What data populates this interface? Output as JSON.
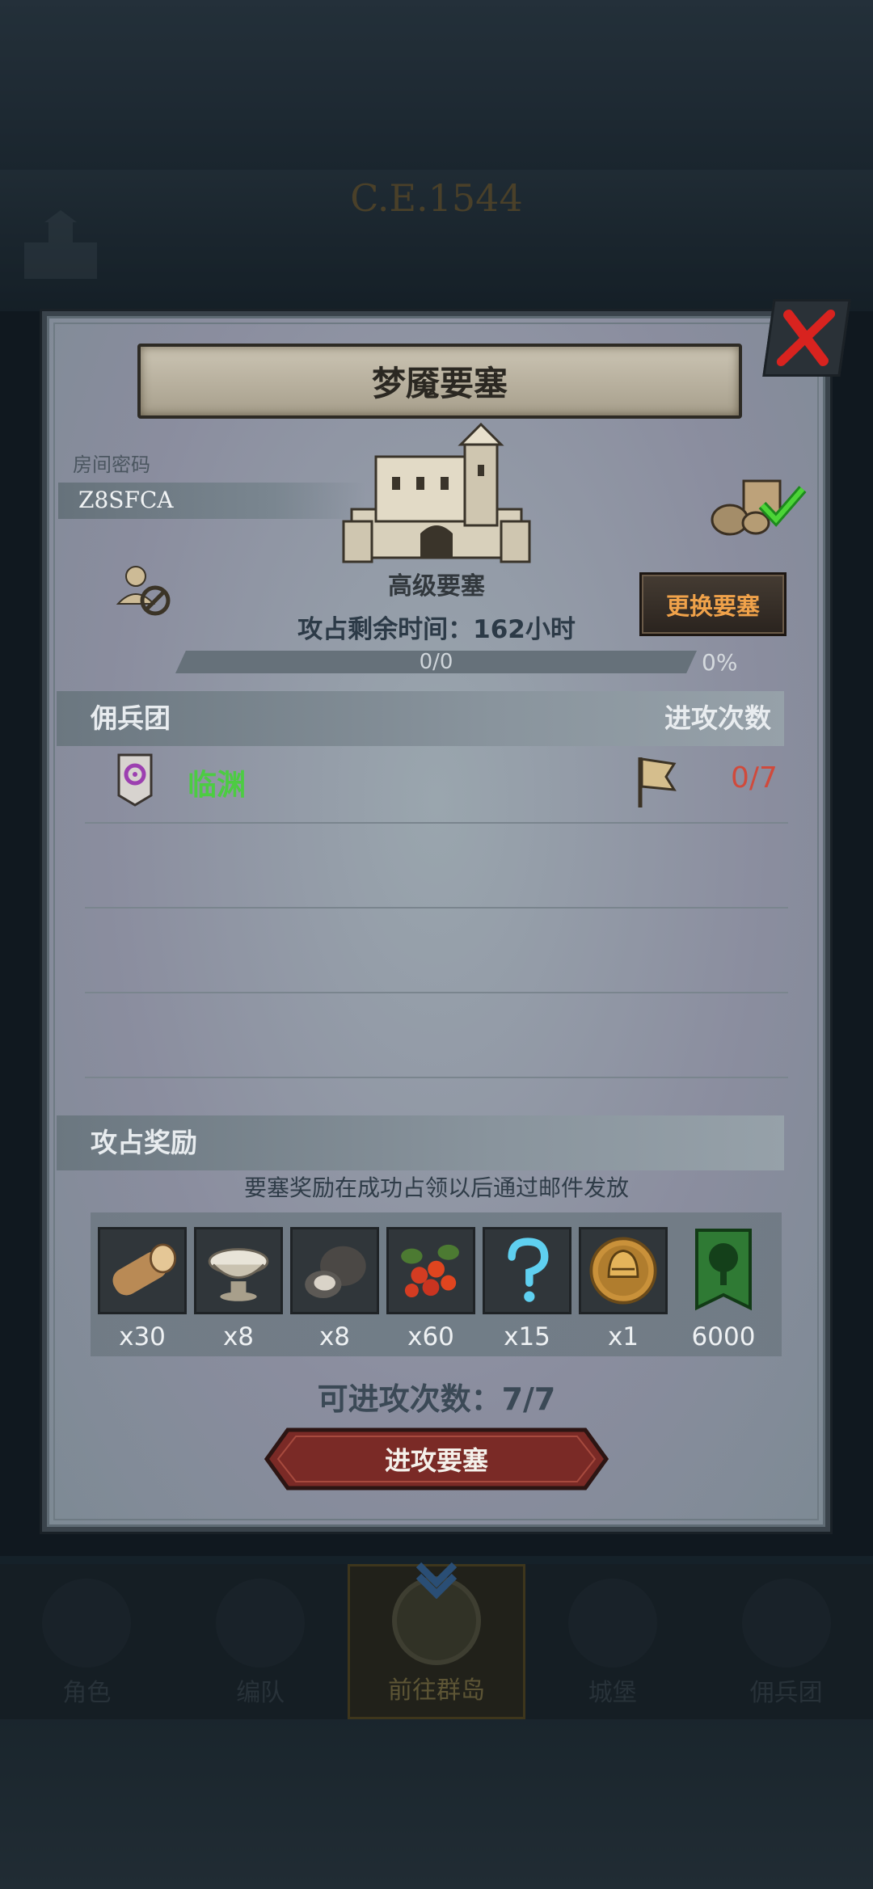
{
  "background": {
    "era": "C.E.1544"
  },
  "dialog": {
    "title": "梦魇要塞",
    "room": {
      "label": "房间密码",
      "code": "Z8SFCA"
    },
    "fortress_level": "高级要塞",
    "time_remaining": "攻占剩余时间：162小时",
    "change_button": "更换要塞",
    "progress": {
      "text": "0/0",
      "percent_text": "0%",
      "value": 0
    },
    "mercenary_section": {
      "title": "佣兵团",
      "right_title": "进攻次数"
    },
    "guild_rows": [
      {
        "name": "临渊",
        "attacks": "0/7"
      }
    ],
    "reward_section": {
      "title": "攻占奖励",
      "note": "要塞奖励在成功占领以后通过邮件发放"
    },
    "rewards": [
      {
        "icon": "wood-log-icon",
        "qty": "x30"
      },
      {
        "icon": "silver-bowl-icon",
        "qty": "x8"
      },
      {
        "icon": "ore-stone-icon",
        "qty": "x8"
      },
      {
        "icon": "red-berries-icon",
        "qty": "x60"
      },
      {
        "icon": "mystery-question-icon",
        "qty": "x15"
      },
      {
        "icon": "gold-helmet-medal-icon",
        "qty": "x1"
      },
      {
        "icon": "tree-banner-icon",
        "qty": "6000"
      }
    ],
    "attacks_available": "可进攻次数：7/7",
    "attack_button": "进攻要塞"
  },
  "bottom_nav": {
    "items": [
      {
        "label": "角色",
        "icon": "knight-icon",
        "active": false
      },
      {
        "label": "编队",
        "icon": "formation-icon",
        "active": false
      },
      {
        "label": "前往群岛",
        "icon": "island-map-icon",
        "active": true
      },
      {
        "label": "城堡",
        "icon": "castle-icon",
        "active": false
      },
      {
        "label": "佣兵团",
        "icon": "mercenary-icon",
        "active": false
      }
    ]
  },
  "colors": {
    "guild_name": "#4ccc42",
    "attack_count": "#d04a3c",
    "change_button_text": "#f0a24a",
    "attack_button": "#7a2a26"
  }
}
